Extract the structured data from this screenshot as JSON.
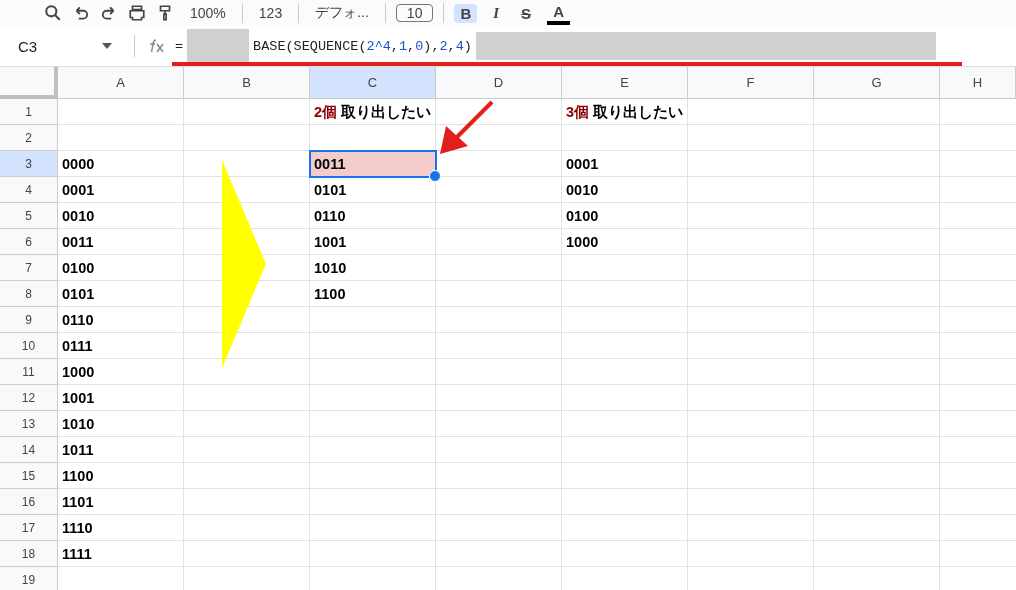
{
  "toolbar": {
    "zoom": "100%",
    "number_format": "123",
    "font": "デフォ...",
    "font_size": "10",
    "bold": {
      "label": "B",
      "selected": true
    },
    "italic": "I",
    "strikethrough": "S",
    "text_color": "A"
  },
  "formula_bar": {
    "name_box": "C3",
    "tokens": [
      {
        "kind": "text",
        "text": "="
      },
      {
        "kind": "redacted"
      },
      {
        "kind": "text",
        "text": "BASE(SEQUENCE("
      },
      {
        "kind": "number",
        "text": "2^4"
      },
      {
        "kind": "text",
        "text": ","
      },
      {
        "kind": "number",
        "text": "1"
      },
      {
        "kind": "text",
        "text": ","
      },
      {
        "kind": "number",
        "text": "0"
      },
      {
        "kind": "text",
        "text": "),"
      },
      {
        "kind": "number",
        "text": "2"
      },
      {
        "kind": "text",
        "text": ","
      },
      {
        "kind": "number",
        "text": "4"
      },
      {
        "kind": "text",
        "text": ")"
      },
      {
        "kind": "redacted"
      }
    ]
  },
  "columns": [
    {
      "label": "A",
      "selected": false
    },
    {
      "label": "B",
      "selected": false
    },
    {
      "label": "C",
      "selected": true
    },
    {
      "label": "D",
      "selected": false
    },
    {
      "label": "E",
      "selected": false
    },
    {
      "label": "F",
      "selected": false
    },
    {
      "label": "G",
      "selected": false
    },
    {
      "label": "H",
      "selected": false
    }
  ],
  "rows": [
    {
      "number": "1",
      "selected": false,
      "cells": {
        "C": {
          "selected": false,
          "parts": [
            {
              "kind": "accent",
              "text": "2個"
            },
            {
              "kind": "plain",
              "text": "取り出したい"
            }
          ]
        },
        "E": {
          "selected": false,
          "parts": [
            {
              "kind": "accent",
              "text": "3個"
            },
            {
              "kind": "plain",
              "text": "取り出したい"
            }
          ]
        }
      }
    },
    {
      "number": "2",
      "selected": false,
      "cells": {}
    },
    {
      "number": "3",
      "selected": true,
      "cells": {
        "A": {
          "text": "0000",
          "selected": false
        },
        "C": {
          "text": "0011",
          "selected": true,
          "color": "#f4cccc"
        },
        "E": {
          "text": "0001",
          "selected": false
        }
      }
    },
    {
      "number": "4",
      "selected": false,
      "cells": {
        "A": {
          "text": "0001",
          "selected": false
        },
        "C": {
          "text": "0101",
          "selected": false
        },
        "E": {
          "text": "0010",
          "selected": false
        }
      }
    },
    {
      "number": "5",
      "selected": false,
      "cells": {
        "A": {
          "text": "0010",
          "selected": false
        },
        "C": {
          "text": "0110",
          "selected": false
        },
        "E": {
          "text": "0100",
          "selected": false
        }
      }
    },
    {
      "number": "6",
      "selected": false,
      "cells": {
        "A": {
          "text": "0011",
          "selected": false
        },
        "C": {
          "text": "1001",
          "selected": false
        },
        "E": {
          "text": "1000",
          "selected": false
        }
      }
    },
    {
      "number": "7",
      "selected": false,
      "cells": {
        "A": {
          "text": "0100",
          "selected": false
        },
        "C": {
          "text": "1010",
          "selected": false
        }
      }
    },
    {
      "number": "8",
      "selected": false,
      "cells": {
        "A": {
          "text": "0101",
          "selected": false
        },
        "C": {
          "text": "1100",
          "selected": false
        }
      }
    },
    {
      "number": "9",
      "selected": false,
      "cells": {
        "A": {
          "text": "0110",
          "selected": false
        }
      }
    },
    {
      "number": "10",
      "selected": false,
      "cells": {
        "A": {
          "text": "0111",
          "selected": false
        }
      }
    },
    {
      "number": "11",
      "selected": false,
      "cells": {
        "A": {
          "text": "1000",
          "selected": false
        }
      }
    },
    {
      "number": "12",
      "selected": false,
      "cells": {
        "A": {
          "text": "1001",
          "selected": false
        }
      }
    },
    {
      "number": "13",
      "selected": false,
      "cells": {
        "A": {
          "text": "1010",
          "selected": false
        }
      }
    },
    {
      "number": "14",
      "selected": false,
      "cells": {
        "A": {
          "text": "1011",
          "selected": false
        }
      }
    },
    {
      "number": "15",
      "selected": false,
      "cells": {
        "A": {
          "text": "1100",
          "selected": false
        }
      }
    },
    {
      "number": "16",
      "selected": false,
      "cells": {
        "A": {
          "text": "1101",
          "selected": false
        }
      }
    },
    {
      "number": "17",
      "selected": false,
      "cells": {
        "A": {
          "text": "1110",
          "selected": false
        }
      }
    },
    {
      "number": "18",
      "selected": false,
      "cells": {
        "A": {
          "text": "1111",
          "selected": false
        }
      }
    },
    {
      "number": "19",
      "selected": false,
      "cells": {}
    }
  ]
}
